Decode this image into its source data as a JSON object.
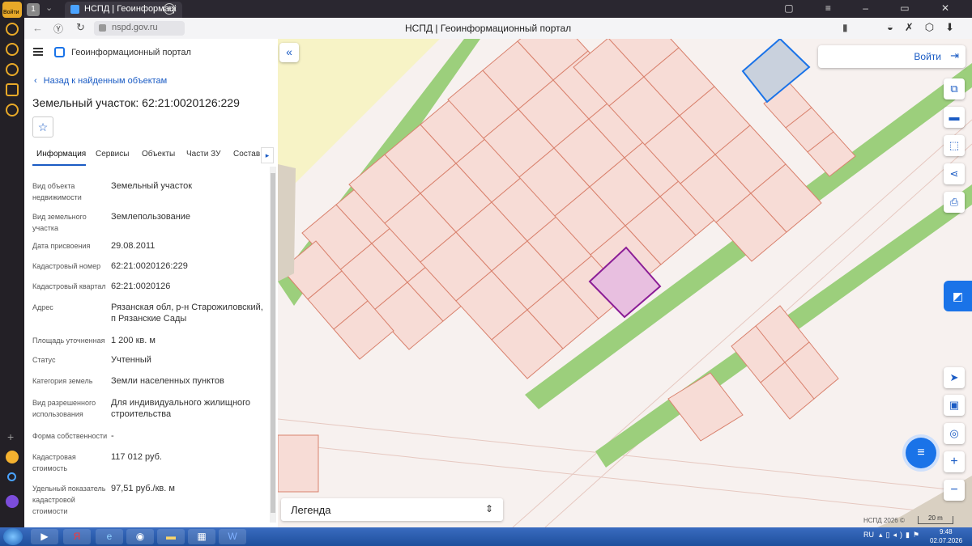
{
  "browser": {
    "sidebar_label": "Войти",
    "tab_count": "1",
    "tab_title": "НСПД | Геоинформаці",
    "address": "nspd.gov.ru",
    "page_title": "НСПД | Геоинформационный портал"
  },
  "header": {
    "portal_name": "Геоинформационный портал"
  },
  "panel": {
    "back_link": "Назад к найденным объектам",
    "object_title": "Земельный участок: 62:21:0020126:229",
    "tabs": [
      "Информация",
      "Сервисы",
      "Объекты",
      "Части ЗУ",
      "Состав"
    ],
    "rows": [
      {
        "k": "Вид объекта недвижимости",
        "v": "Земельный участок"
      },
      {
        "k": "Вид земельного участка",
        "v": "Землепользование"
      },
      {
        "k": "Дата присвоения",
        "v": "29.08.2011"
      },
      {
        "k": "Кадастровый номер",
        "v": "62:21:0020126:229"
      },
      {
        "k": "Кадастровый квартал",
        "v": "62:21:0020126"
      },
      {
        "k": "Адрес",
        "v": "Рязанская обл, р-н Старожиловский, п Рязанские Сады"
      },
      {
        "k": "Площадь уточненная",
        "v": "1 200 кв. м"
      },
      {
        "k": "Статус",
        "v": "Учтенный"
      },
      {
        "k": "Категория земель",
        "v": "Земли населенных пунктов"
      },
      {
        "k": "Вид разрешенного использования",
        "v": "Для индивидуального жилищного строительства"
      },
      {
        "k": "Форма собственности",
        "v": "-"
      },
      {
        "k": "Кадастровая стоимость",
        "v": "117 012 руб."
      },
      {
        "k": "Удельный показатель кадастровой стоимости",
        "v": "97,51 руб./кв. м"
      }
    ]
  },
  "map": {
    "login_label": "Войти",
    "legend_label": "Легенда",
    "copyright": "НСПД 2026 ©",
    "scale": "20 m",
    "colors": {
      "parcel_fill": "#f7dcd6",
      "parcel_stroke": "#d9826e",
      "green": "#9ccf7c",
      "selected_fill": "#e8bfe0",
      "selected_stroke": "#8b1d96",
      "blue_fill": "#c9d1dd",
      "blue_stroke": "#1a73e8"
    }
  },
  "taskbar": {
    "lang": "RU",
    "time": "9:48",
    "date": "02.07.2026"
  }
}
